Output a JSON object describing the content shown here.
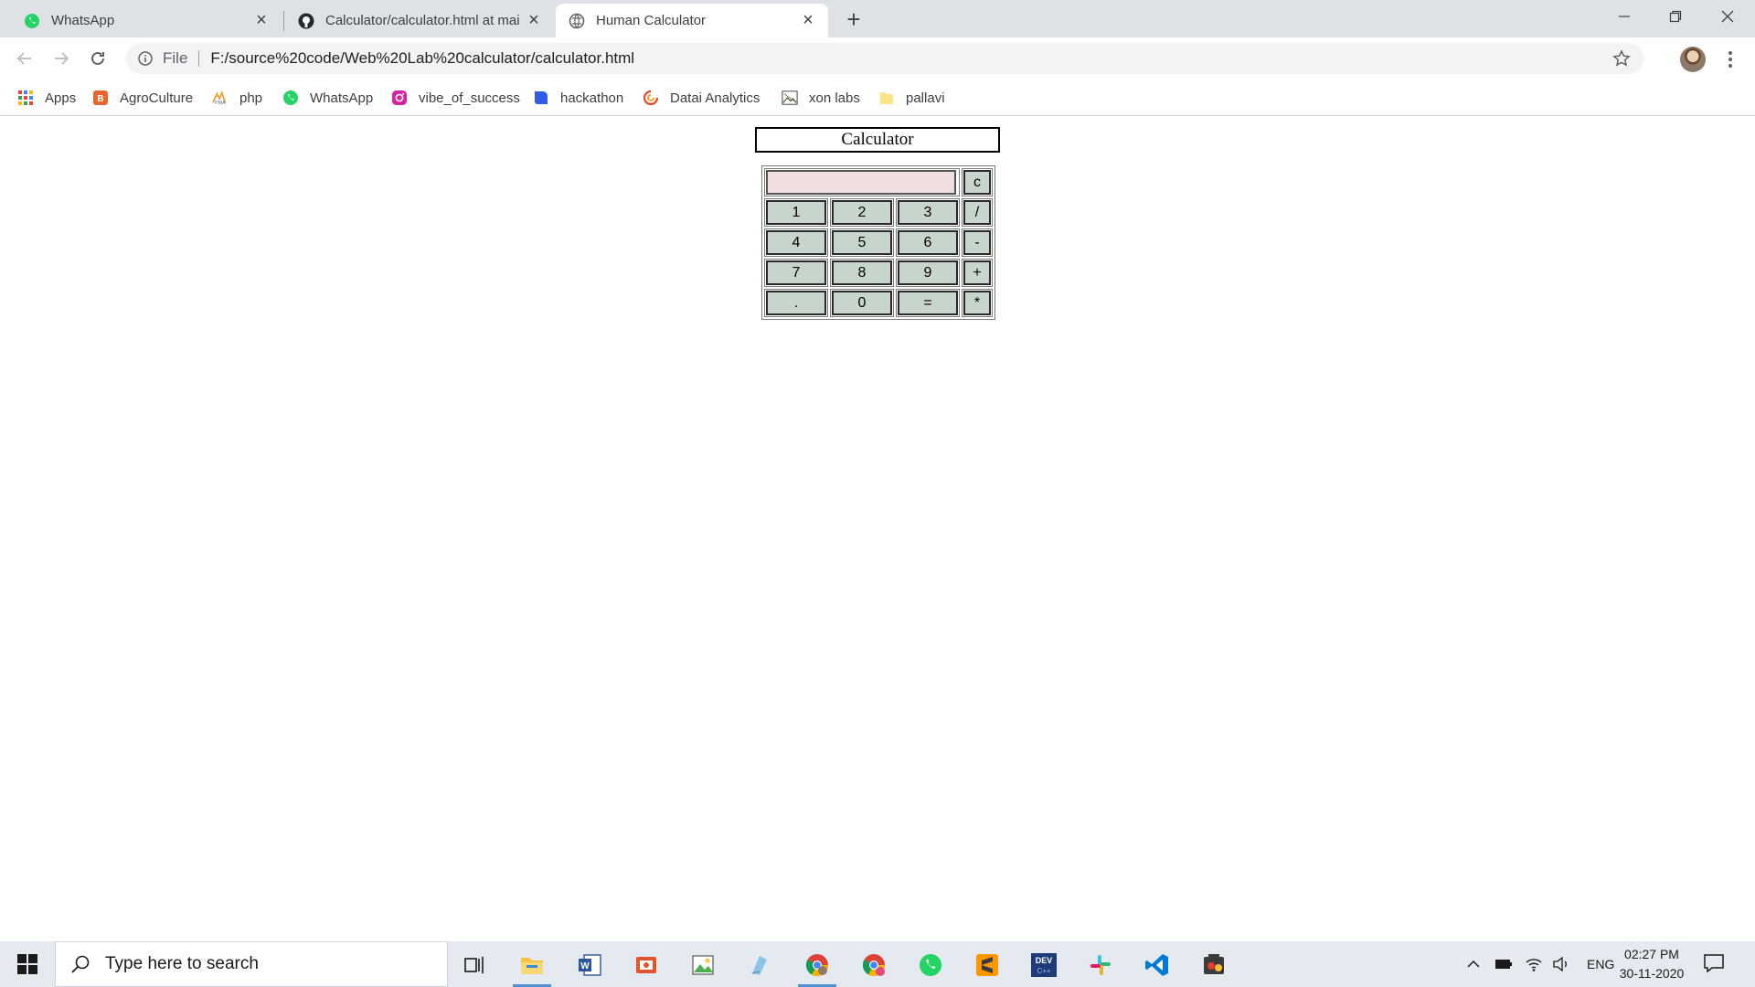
{
  "browser": {
    "tabs": [
      {
        "title": "WhatsApp",
        "icon": "whatsapp-icon",
        "active": false
      },
      {
        "title": "Calculator/calculator.html at mai",
        "icon": "github-icon",
        "active": false
      },
      {
        "title": "Human Calculator",
        "icon": "globe-icon",
        "active": true
      }
    ],
    "address": {
      "scheme_label": "File",
      "url": "F:/source%20code/Web%20Lab%20calculator/calculator.html"
    },
    "bookmarks": [
      {
        "label": "Apps",
        "icon": "apps-grid-icon"
      },
      {
        "label": "AgroCulture",
        "icon": "agroculture-icon"
      },
      {
        "label": "php",
        "icon": "phpmyadmin-icon"
      },
      {
        "label": "WhatsApp",
        "icon": "whatsapp-icon"
      },
      {
        "label": "vibe_of_success",
        "icon": "instagram-icon"
      },
      {
        "label": "hackathon",
        "icon": "bookmark-blue-icon"
      },
      {
        "label": "Datai Analytics",
        "icon": "datai-icon"
      },
      {
        "label": "xon labs",
        "icon": "image-icon"
      },
      {
        "label": "pallavi",
        "icon": "folder-icon"
      }
    ]
  },
  "calculator": {
    "title": "Calculator",
    "display_value": "",
    "clear_label": "c",
    "rows": [
      {
        "digits": [
          "1",
          "2",
          "3"
        ],
        "op": "/"
      },
      {
        "digits": [
          "4",
          "5",
          "6"
        ],
        "op": "-"
      },
      {
        "digits": [
          "7",
          "8",
          "9"
        ],
        "op": "+"
      },
      {
        "digits": [
          ".",
          "0",
          "="
        ],
        "op": "*"
      }
    ],
    "colors": {
      "button_bg": "#c8d5cc",
      "display_bg": "#f1dede"
    }
  },
  "taskbar": {
    "search_placeholder": "Type here to search",
    "apps": [
      "task-view-icon",
      "file-explorer-icon",
      "word-icon",
      "screen-recorder-icon",
      "image-viewer-icon",
      "notes-icon",
      "chrome-icon",
      "chrome-profile-icon",
      "whatsapp-icon",
      "sublime-text-icon",
      "dev-cpp-icon",
      "slack-icon",
      "vscode-icon",
      "media-app-icon"
    ],
    "language": "ENG",
    "time": "02:27 PM",
    "date": "30-11-2020"
  }
}
